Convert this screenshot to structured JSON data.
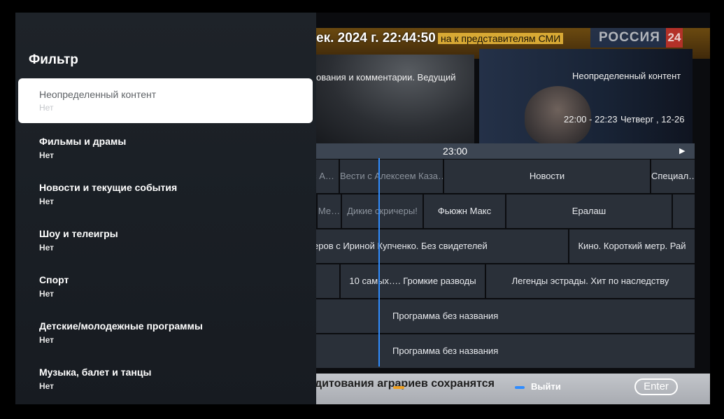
{
  "broadcast": {
    "datetime": "ек. 2024 г. 22:44:50",
    "ticker": "на к представителям СМИ",
    "channel_name": "РОССИЯ",
    "channel_number": "24",
    "bottom_ticker": "дитования аграриев сохранятся"
  },
  "preview": {
    "description": "ования и комментарии. Ведущий",
    "content_type": "Неопределенный контент",
    "time_range": "22:00 - 22:23",
    "day": "Четверг , 12-26"
  },
  "timeline": {
    "label": "23:00",
    "next_icon": "arrow-right-icon"
  },
  "guide": {
    "rows": [
      [
        {
          "title": "с А…",
          "dim": true
        },
        {
          "title": "Вести с Алексеем Каза…",
          "dim": false
        },
        {
          "title": "Новости",
          "dim": false
        },
        {
          "title": "Специал…",
          "dim": false
        }
      ],
      [
        {
          "title": "Ме…",
          "dim": true
        },
        {
          "title": "Дикие скричеры!",
          "dim": false
        },
        {
          "title": "Фьюжн Макс",
          "dim": false
        },
        {
          "title": "Ералаш",
          "dim": false
        },
        {
          "title": "",
          "dim": false
        }
      ],
      [
        {
          "title": "еров с Ириной Купченко. Без свидетелей",
          "dim": false
        },
        {
          "title": "Кино. Короткий метр. Рай",
          "dim": false
        }
      ],
      [
        {
          "title": "",
          "dim": false
        },
        {
          "title": "10 самых…. Громкие разводы",
          "dim": false
        },
        {
          "title": "Легенды эстрады. Хит по наследству",
          "dim": false
        }
      ],
      [
        {
          "title": "",
          "dim": false
        },
        {
          "title": "Программа без названия",
          "dim": false
        }
      ],
      [
        {
          "title": "",
          "dim": false
        },
        {
          "title": "Программа без названия",
          "dim": false
        }
      ]
    ]
  },
  "hints": {
    "exit_label": "Выйти",
    "enter_label": "Enter"
  },
  "filter": {
    "title": "Фильтр",
    "items": [
      {
        "label": "Неопределенный контент",
        "value": "Нет",
        "selected": true
      },
      {
        "label": "Фильмы и драмы",
        "value": "Нет",
        "selected": false
      },
      {
        "label": "Новости и текущие события",
        "value": "Нет",
        "selected": false
      },
      {
        "label": "Шоу и телеигры",
        "value": "Нет",
        "selected": false
      },
      {
        "label": "Спорт",
        "value": "Нет",
        "selected": false
      },
      {
        "label": "Детские/молодежные программы",
        "value": "Нет",
        "selected": false
      },
      {
        "label": "Музыка, балет и танцы",
        "value": "Нет",
        "selected": false
      }
    ]
  },
  "colors": {
    "accent_blue": "#2f8cff",
    "hint_yellow": "#f0a020",
    "panel_bg": "#1e2329",
    "selected_bg": "#ffffff"
  }
}
